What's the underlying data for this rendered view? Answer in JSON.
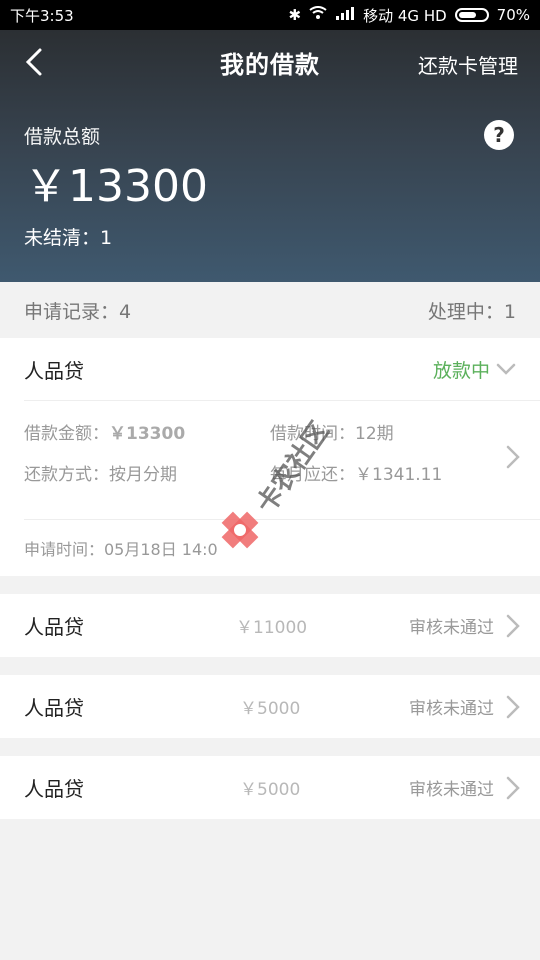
{
  "status_bar": {
    "time": "下午3:53",
    "carrier": "移动 4G HD",
    "battery": "70%",
    "icons": [
      "bluetooth-icon",
      "wifi-icon",
      "signal-icon",
      "battery-icon"
    ]
  },
  "nav": {
    "back_icon": "chevron-left-icon",
    "title": "我的借款",
    "right_action": "还款卡管理"
  },
  "hero": {
    "total_label": "借款总额",
    "amount": "￥13300",
    "unsettled": "未结清：1",
    "help_icon": "?"
  },
  "summary": {
    "records": "申请记录：4",
    "processing": "处理中：1"
  },
  "loans": [
    {
      "name": "人品贷",
      "status": "放款中",
      "details": {
        "amount_label": "借款金额：",
        "amount": "￥13300",
        "term_label": "借款时间：",
        "term": "12期",
        "method_label": "还款方式：",
        "method": "按月分期",
        "monthly_label": "每月应还：",
        "monthly": "￥1341.11"
      },
      "apply_time": "申请时间：05月18日 14:0"
    },
    {
      "name": "人品贷",
      "amount": "￥11000",
      "status": "审核未通过"
    },
    {
      "name": "人品贷",
      "amount": "￥5000",
      "status": "审核未通过"
    },
    {
      "name": "人品贷",
      "amount": "￥5000",
      "status": "审核未通过"
    }
  ],
  "watermark": {
    "text": "卡农社区"
  },
  "colors": {
    "green": "#5bb05b",
    "hero_top": "#2b2f33",
    "hero_bottom": "#3f596f"
  }
}
